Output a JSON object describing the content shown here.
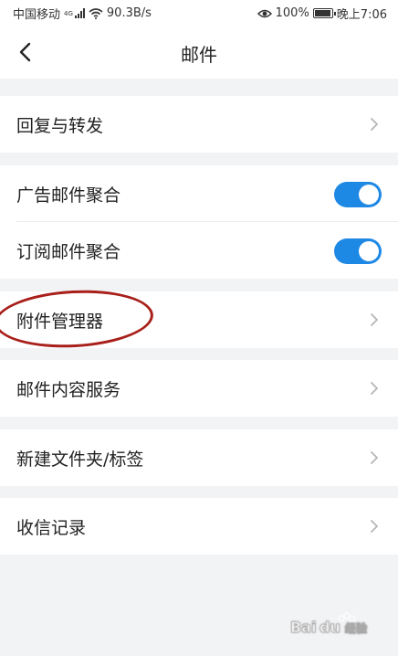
{
  "status_bar": {
    "carrier": "中国移动",
    "network": "4G",
    "speed": "90.3B/s",
    "battery": "100%",
    "battery_level": 1.0,
    "time": "晚上7:06"
  },
  "header": {
    "title": "邮件",
    "back_icon": "chevron-left-icon"
  },
  "items": {
    "reply_forward": {
      "label": "回复与转发"
    },
    "ad_aggregate": {
      "label": "广告邮件聚合",
      "enabled": true
    },
    "subscription_aggregate": {
      "label": "订阅邮件聚合",
      "enabled": true
    },
    "attachment_manager": {
      "label": "附件管理器"
    },
    "content_service": {
      "label": "邮件内容服务"
    },
    "new_folder_tag": {
      "label": "新建文件夹/标签"
    },
    "receive_log": {
      "label": "收信记录"
    }
  },
  "colors": {
    "toggle_on": "#1e88e5",
    "highlight": "#a81f1a",
    "background": "#f2f3f5"
  },
  "watermark": {
    "logo": "Baidu经验"
  }
}
